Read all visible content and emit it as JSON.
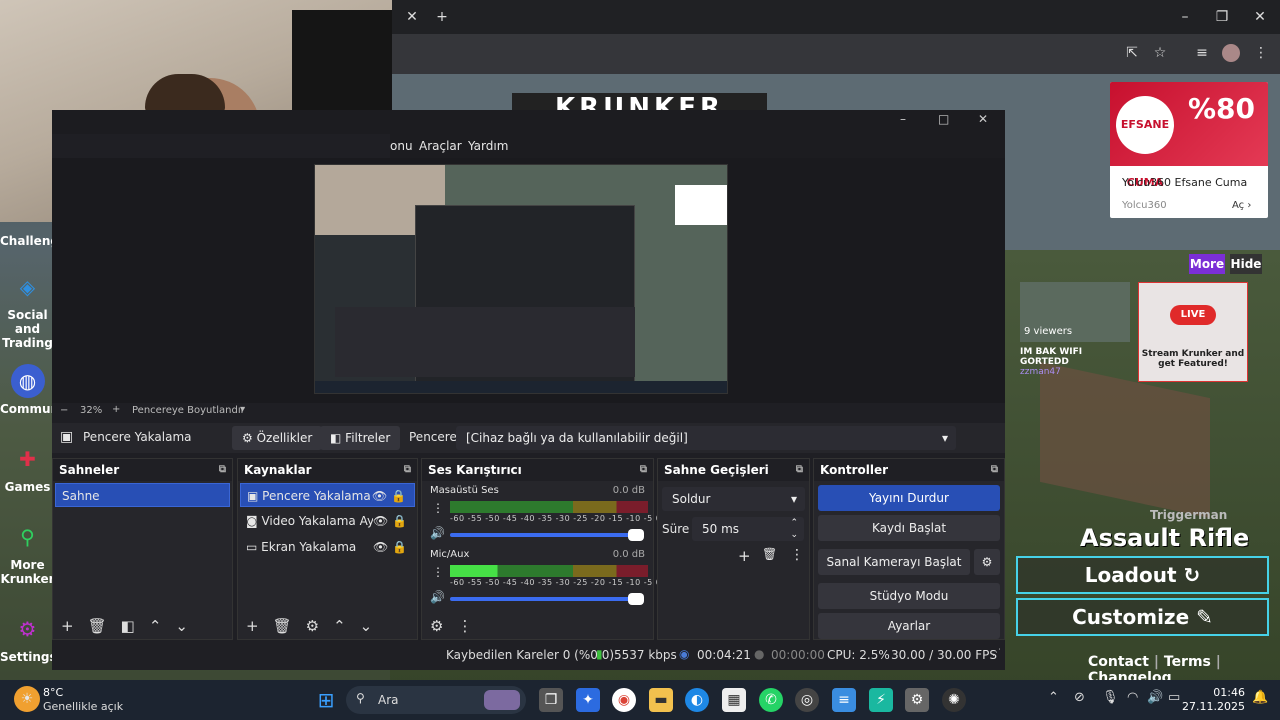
{
  "obs": {
    "menu": [
      "onu",
      "Araçlar",
      "Yardım"
    ],
    "zoom": "32%",
    "fit_label": "Pencereye Boyutlandır",
    "source_name": "Pencere Yakalama",
    "props_button": "Özellikler",
    "filters_button": "Filtreler",
    "window_label": "Pencere",
    "window_value": "[Cihaz bağlı ya da kullanılabilir değil]",
    "scenes": {
      "title": "Sahneler",
      "items": [
        "Sahne"
      ]
    },
    "sources": {
      "title": "Kaynaklar",
      "items": [
        "Pencere Yakalama",
        "Video Yakalama Aygı",
        "Ekran Yakalama"
      ]
    },
    "mixer": {
      "title": "Ses Karıştırıcı",
      "channels": [
        {
          "name": "Masaüstü Ses",
          "db": "0.0 dB"
        },
        {
          "name": "Mic/Aux",
          "db": "0.0 dB"
        }
      ],
      "scale": "-60 -55 -50 -45 -40 -35 -30 -25 -20 -15 -10 -5 0"
    },
    "transitions": {
      "title": "Sahne Geçişleri",
      "type": "Soldur",
      "duration_label": "Süre",
      "duration": "50 ms"
    },
    "controls": {
      "title": "Kontroller",
      "buttons": [
        "Yayını Durdur",
        "Kaydı Başlat",
        "Sanal Kamerayı Başlat",
        "Stüdyo Modu",
        "Ayarlar"
      ]
    },
    "status": {
      "dropped": "Kaybedilen Kareler 0 (%0.0)",
      "bitrate": "5537 kbps",
      "stream_time": "00:04:21",
      "rec_time": "00:00:00",
      "cpu": "CPU: 2.5%",
      "fps": "30.00 / 30.00 FPS"
    }
  },
  "game": {
    "sidebar": [
      "Challenge",
      "Social and Trading",
      "Communi",
      "Games",
      "More Krunker",
      "Settings"
    ],
    "more_button": "More",
    "hide_button": "Hide",
    "streams": [
      {
        "viewers": "9 viewers",
        "title": "IM BAK WIFI GORTEDD",
        "user": "zzman47"
      },
      {
        "live": "LIVE",
        "title": "Stream Krunker and get Featured!"
      }
    ],
    "player": "Triggerman",
    "weapon": "Assault Rifle",
    "loadout": "Loadout",
    "customize": "Customize",
    "footer_links": [
      "Contact",
      "Terms",
      "Changelog"
    ],
    "logo": "KRUNKER"
  },
  "ad": {
    "title": "Yolcu360 Efsane Cuma",
    "brand": "Yolcu360",
    "cta": "Aç",
    "headline": "EFSANE CUMA",
    "discount": "%80"
  },
  "taskbar": {
    "weather_temp": "8°C",
    "weather_desc": "Genellikle açık",
    "search": "Ara",
    "time": "01:46",
    "date": "27.11.2025"
  },
  "colors": {
    "accent": "#284fb5",
    "game_outline": "#46d2e8",
    "more_btn": "#7b2fd6"
  }
}
